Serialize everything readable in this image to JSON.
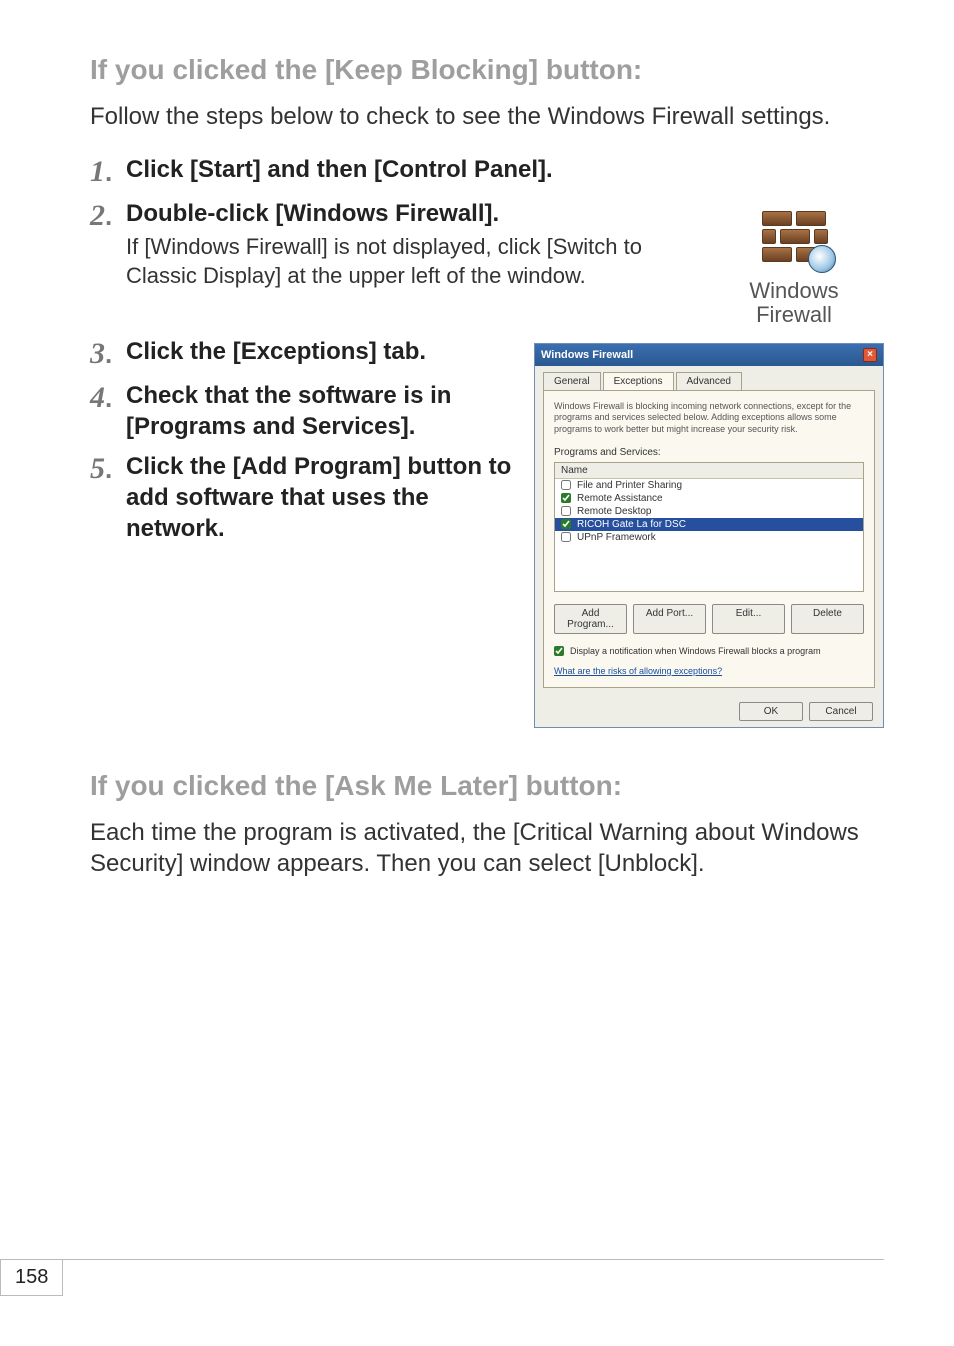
{
  "section1": {
    "title": "If you clicked the [Keep Blocking] button:",
    "intro": "Follow the steps below to check to see the Windows Firewall settings."
  },
  "steps": {
    "s1": {
      "num": "1",
      "bold": "Click [Start] and then [Control Panel]."
    },
    "s2": {
      "num": "2",
      "bold": "Double-click [Windows Firewall].",
      "desc": "If [Windows Firewall] is not displayed, click [Switch to Classic Display] at the upper left of the window."
    },
    "s3": {
      "num": "3",
      "bold": "Click the [Exceptions] tab."
    },
    "s4": {
      "num": "4",
      "bold": "Check that the software is in [Programs and Services]."
    },
    "s5": {
      "num": "5",
      "bold": "Click the [Add Program] button to add software that uses the network."
    }
  },
  "wf_icon": {
    "label_line1": "Windows",
    "label_line2": "Firewall"
  },
  "dialog": {
    "title": "Windows Firewall",
    "tabs": {
      "general": "General",
      "exceptions": "Exceptions",
      "advanced": "Advanced"
    },
    "panel_text": "Windows Firewall is blocking incoming network connections, except for the programs and services selected below. Adding exceptions allows some programs to work better but might increase your security risk.",
    "ps_label": "Programs and Services:",
    "col_name": "Name",
    "items": {
      "i0": {
        "label": "File and Printer Sharing"
      },
      "i1": {
        "label": "Remote Assistance"
      },
      "i2": {
        "label": "Remote Desktop"
      },
      "i3": {
        "label": "RICOH Gate La for DSC"
      },
      "i4": {
        "label": "UPnP Framework"
      }
    },
    "buttons": {
      "add_program": "Add Program...",
      "add_port": "Add Port...",
      "edit": "Edit...",
      "delete": "Delete"
    },
    "notif": "Display a notification when Windows Firewall blocks a program",
    "risk_link": "What are the risks of allowing exceptions?",
    "ok": "OK",
    "cancel": "Cancel"
  },
  "section2": {
    "title": "If you clicked the [Ask Me Later] button:",
    "body": "Each time the program is activated, the [Critical Warning about Windows Security] window appears. Then you can select [Unblock]."
  },
  "page_number": "158"
}
